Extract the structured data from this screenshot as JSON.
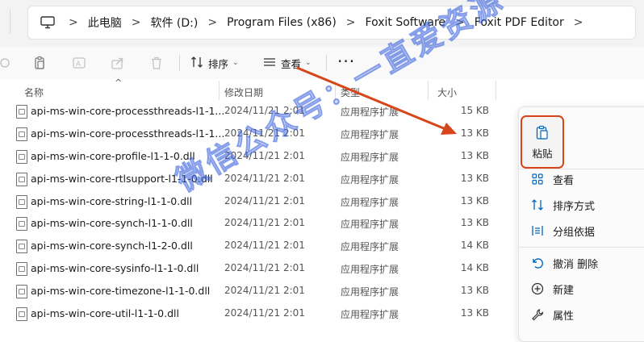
{
  "address": {
    "breadcrumbs": [
      "此电脑",
      "软件 (D:)",
      "Program Files (x86)",
      "Foxit Software",
      "Foxit PDF Editor"
    ],
    "separator": ">"
  },
  "toolbar": {
    "sort_label": "排序",
    "view_label": "查看",
    "more_label": "···"
  },
  "columns": {
    "name": "名称",
    "date": "修改日期",
    "type": "类型",
    "size": "大小"
  },
  "files": [
    {
      "name": "api-ms-win-core-processthreads-l1-1...",
      "date": "2024/11/21 2:01",
      "type": "应用程序扩展",
      "size": "15 KB"
    },
    {
      "name": "api-ms-win-core-processthreads-l1-1...",
      "date": "2024/11/21 2:01",
      "type": "应用程序扩展",
      "size": "13 KB"
    },
    {
      "name": "api-ms-win-core-profile-l1-1-0.dll",
      "date": "2024/11/21 2:01",
      "type": "应用程序扩展",
      "size": "13 KB"
    },
    {
      "name": "api-ms-win-core-rtlsupport-l1-1-0.dll",
      "date": "2024/11/21 2:01",
      "type": "应用程序扩展",
      "size": "13 KB"
    },
    {
      "name": "api-ms-win-core-string-l1-1-0.dll",
      "date": "2024/11/21 2:01",
      "type": "应用程序扩展",
      "size": "13 KB"
    },
    {
      "name": "api-ms-win-core-synch-l1-1-0.dll",
      "date": "2024/11/21 2:01",
      "type": "应用程序扩展",
      "size": "13 KB"
    },
    {
      "name": "api-ms-win-core-synch-l1-2-0.dll",
      "date": "2024/11/21 2:01",
      "type": "应用程序扩展",
      "size": "14 KB"
    },
    {
      "name": "api-ms-win-core-sysinfo-l1-1-0.dll",
      "date": "2024/11/21 2:01",
      "type": "应用程序扩展",
      "size": "14 KB"
    },
    {
      "name": "api-ms-win-core-timezone-l1-1-0.dll",
      "date": "2024/11/21 2:01",
      "type": "应用程序扩展",
      "size": "13 KB"
    },
    {
      "name": "api-ms-win-core-util-l1-1-0.dll",
      "date": "2024/11/21 2:01",
      "type": "应用程序扩展",
      "size": "13 KB"
    }
  ],
  "context_menu": {
    "paste": "粘贴",
    "view": "查看",
    "sort_by": "排序方式",
    "group_by": "分组依据",
    "undo_delete": "撤消 删除",
    "new": "新建",
    "properties": "属性"
  },
  "watermark": "微信公众号：一直爱资源",
  "colors": {
    "accent": "#0067c0",
    "highlight": "#d6461a"
  }
}
